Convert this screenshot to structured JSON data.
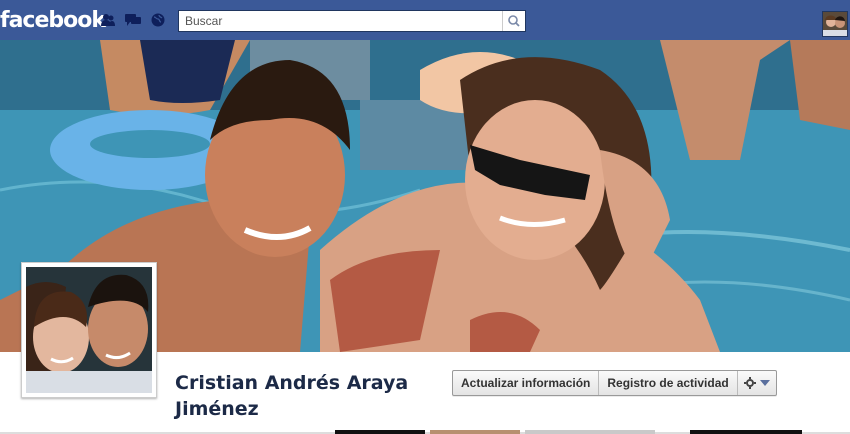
{
  "brand": {
    "logo": "facebook"
  },
  "header": {
    "icons": [
      "friend-requests-icon",
      "messages-icon",
      "notifications-globe-icon"
    ],
    "search": {
      "placeholder": "Buscar",
      "value": ""
    }
  },
  "profile": {
    "name": "Cristian Andrés Araya Jiménez",
    "actions": {
      "update_info": "Actualizar información",
      "activity_log": "Registro de actividad"
    }
  },
  "colors": {
    "brand_blue": "#3b5998",
    "name_text": "#1c2a47"
  }
}
